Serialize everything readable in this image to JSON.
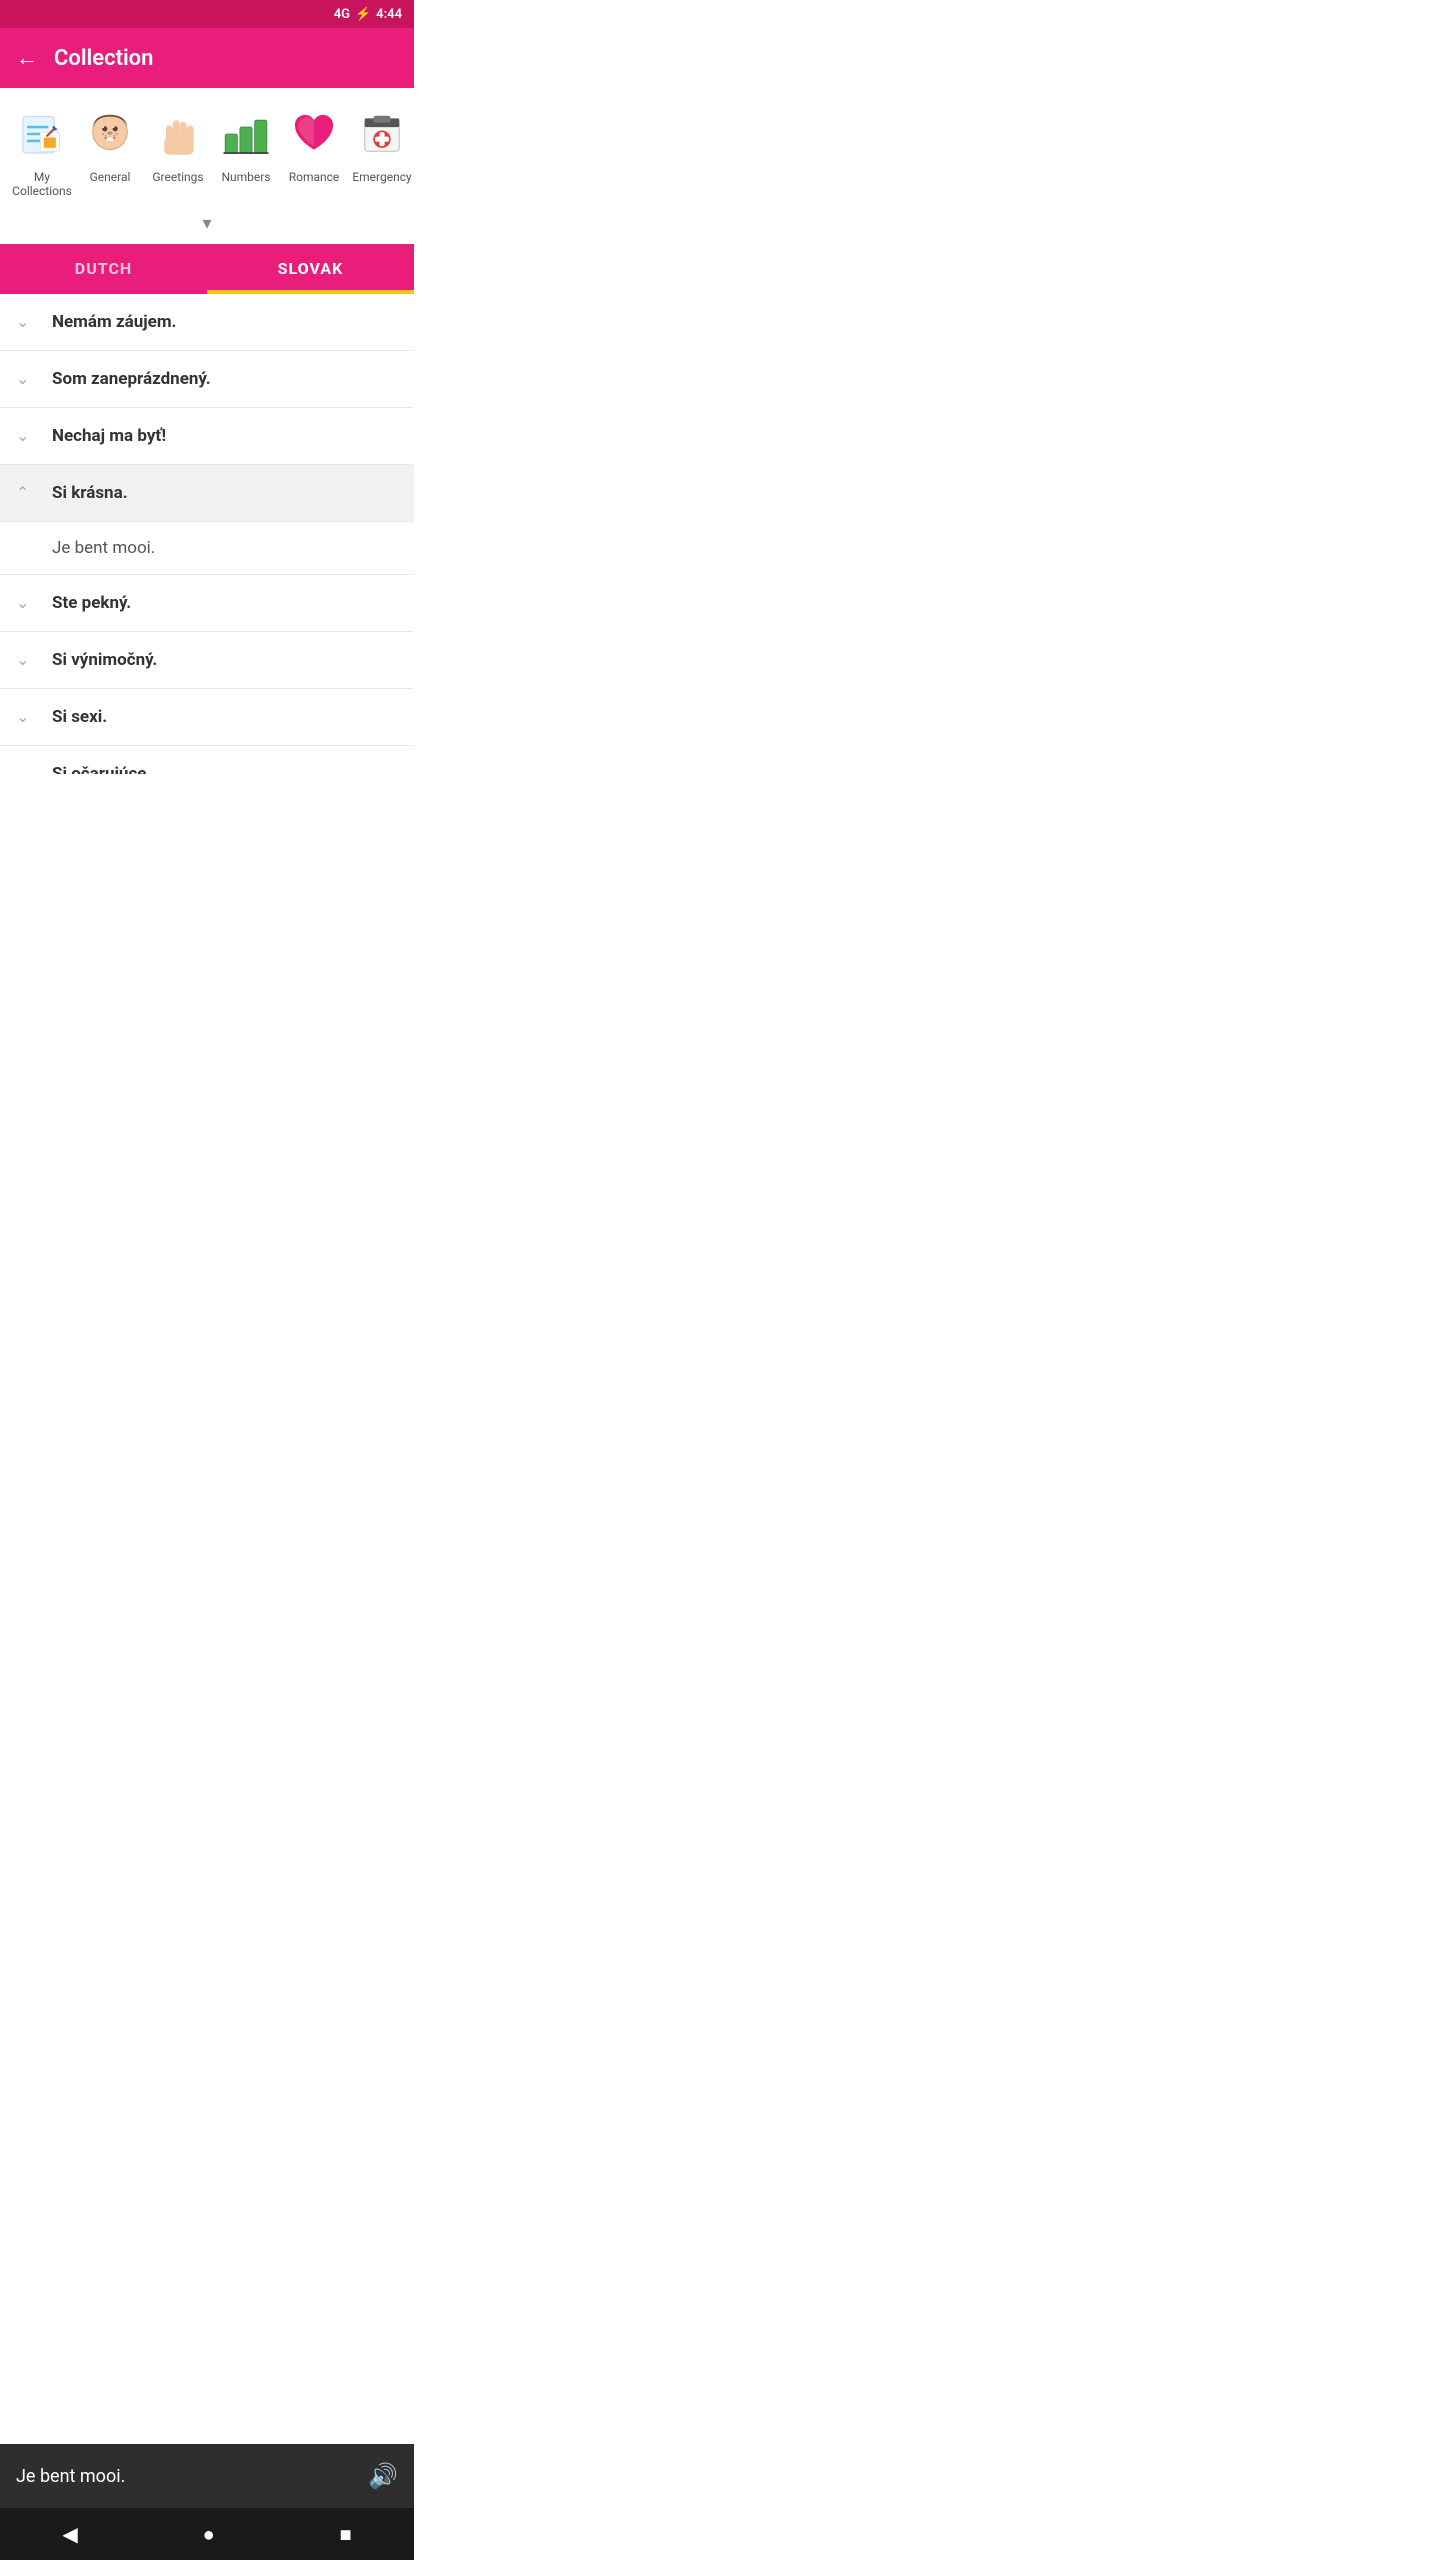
{
  "statusBar": {
    "signal": "4G",
    "battery": "⚡",
    "time": "4:44"
  },
  "header": {
    "backLabel": "←",
    "title": "Collection"
  },
  "categories": [
    {
      "id": "my-collections",
      "label": "My Collections",
      "emoji": "📝"
    },
    {
      "id": "general",
      "label": "General",
      "emoji": "😄"
    },
    {
      "id": "greetings",
      "label": "Greetings",
      "emoji": "✋"
    },
    {
      "id": "numbers",
      "label": "Numbers",
      "emoji": "🔢"
    },
    {
      "id": "romance",
      "label": "Romance",
      "emoji": "❤️"
    },
    {
      "id": "emergency",
      "label": "Emergency",
      "emoji": "🚑"
    }
  ],
  "tabs": [
    {
      "id": "dutch",
      "label": "DUTCH",
      "active": false
    },
    {
      "id": "slovak",
      "label": "SLOVAK",
      "active": true
    }
  ],
  "phrases": [
    {
      "id": 1,
      "text": "Nemám záujem.",
      "expanded": false,
      "translation": null
    },
    {
      "id": 2,
      "text": "Som zaneprázdnený.",
      "expanded": false,
      "translation": null
    },
    {
      "id": 3,
      "text": "Nechaj ma byť!",
      "expanded": false,
      "translation": null
    },
    {
      "id": 4,
      "text": "Si krásna.",
      "expanded": true,
      "translation": "Je bent mooi."
    },
    {
      "id": 5,
      "text": "Ste pekný.",
      "expanded": false,
      "translation": null
    },
    {
      "id": 6,
      "text": "Si výnimočný.",
      "expanded": false,
      "translation": null
    },
    {
      "id": 7,
      "text": "Si sexi.",
      "expanded": false,
      "translation": null
    },
    {
      "id": 8,
      "text": "Si očarujúce.",
      "expanded": false,
      "translation": null
    }
  ],
  "bottomBar": {
    "text": "Je bent mooi.",
    "speakerIcon": "🔊"
  },
  "navBar": {
    "backIcon": "◀",
    "homeIcon": "●",
    "squareIcon": "■"
  }
}
